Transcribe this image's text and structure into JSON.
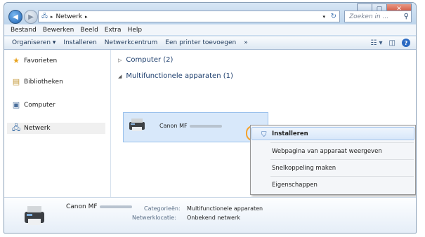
{
  "window": {
    "buttons": {
      "minimize_icon": "minimize-icon",
      "maximize_icon": "maximize-icon",
      "close_icon": "close-icon"
    }
  },
  "address": {
    "crumb": "Netwerk",
    "sep_glyph": "▸"
  },
  "search": {
    "placeholder": "Zoeken in ..."
  },
  "menubar": [
    "Bestand",
    "Bewerken",
    "Beeld",
    "Extra",
    "Help"
  ],
  "toolbar": [
    "Organiseren ▾",
    "Installeren",
    "Netwerkcentrum",
    "Een printer toevoegen",
    "»"
  ],
  "sidebar": [
    {
      "label": "Favorieten",
      "icon": "star-icon"
    },
    {
      "label": "Bibliotheken",
      "icon": "library-icon"
    },
    {
      "label": "Computer",
      "icon": "computer-icon"
    },
    {
      "label": "Netwerk",
      "icon": "network-icon"
    }
  ],
  "content": {
    "groups": [
      {
        "label": "Computer (2)",
        "expanded": false
      },
      {
        "label": "Multifunctionele apparaten (1)",
        "expanded": true
      }
    ],
    "device_name": "Canon MF"
  },
  "context_menu": {
    "items": [
      "Installeren",
      "Webpagina van apparaat weergeven",
      "Snelkoppeling maken",
      "Eigenschappen"
    ],
    "highlighted": "Installeren"
  },
  "details": {
    "name": "Canon MF",
    "category_label": "Categorieën:",
    "category_value": "Multifunctionele apparaten",
    "location_label": "Netwerklocatie:",
    "location_value": "Onbekend netwerk"
  },
  "colors": {
    "highlight_ring": "#f4a22d",
    "selection": "#d8e8fa"
  }
}
